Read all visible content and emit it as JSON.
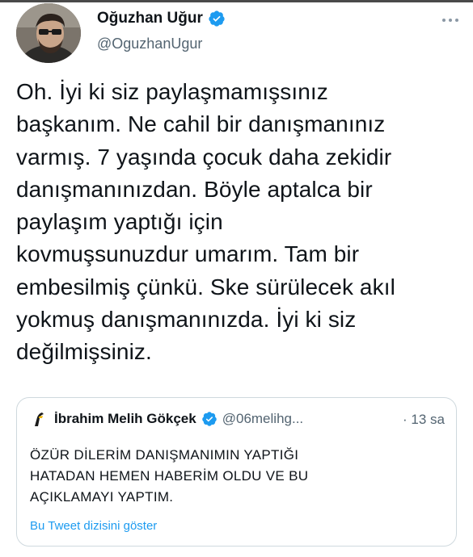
{
  "author": {
    "display_name": "Oğuzhan Uğur",
    "handle": "@OguzhanUgur",
    "verified": true,
    "avatar_icon": "profile-photo"
  },
  "more_icon": "more-dots-icon",
  "tweet": {
    "text": "Oh. İyi ki siz paylaşmamışsınız\nbaşkanım. Ne cahil bir danışmanınız\nvarmış. 7 yaşında çocuk daha zekidir\ndanışmanınızdan. Böyle aptalca bir\npaylaşım yaptığı için\nkovmuşsunuzdur umarım. Tam bir\nembesilmiş çünkü. Ske sürülecek akıl\nyokmuş danışmanınızda. İyi ki siz\ndeğilmişsiniz."
  },
  "quoted_tweet": {
    "display_name": "İbrahim Melih Gökçek",
    "handle": "@06melihg...",
    "verified": true,
    "time": "· 13 sa",
    "text": "ÖZÜR DİLERİM DANIŞMANIMIN YAPTIĞI\nHATADAN HEMEN HABERİM OLDU VE BU\nAÇIKLAMAYI YAPTIM.",
    "show_thread_label": "Bu Tweet dizisini göster"
  },
  "colors": {
    "text": "#0f1419",
    "secondary": "#536471",
    "verified_blue": "#1d9bf0",
    "link": "#1d9bf0",
    "border": "#cfd9de"
  }
}
